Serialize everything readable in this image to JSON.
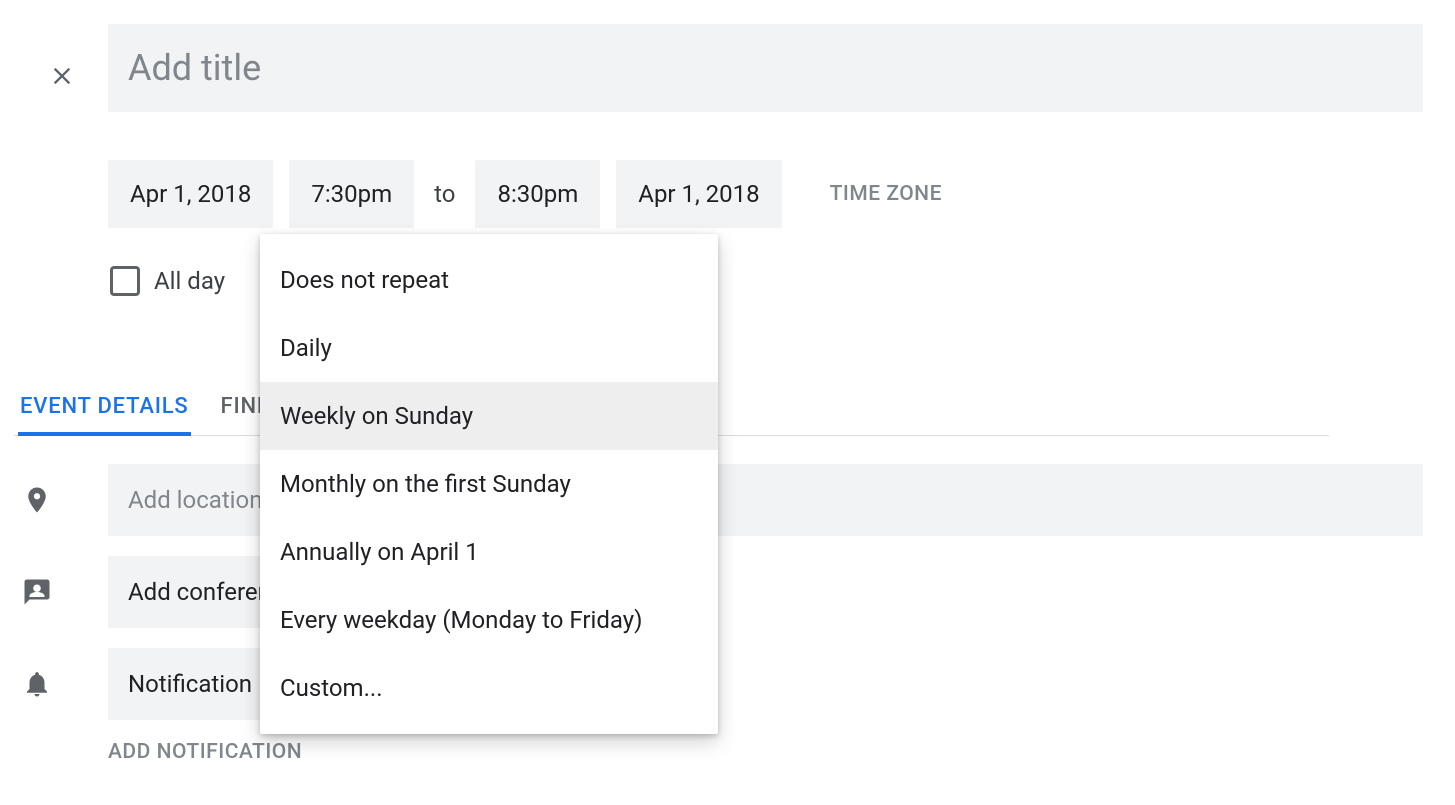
{
  "title": {
    "placeholder": "Add title",
    "value": ""
  },
  "datetime": {
    "start_date": "Apr 1, 2018",
    "start_time": "7:30pm",
    "to_label": "to",
    "end_time": "8:30pm",
    "end_date": "Apr 1, 2018",
    "timezone_label": "TIME ZONE"
  },
  "allday": {
    "label": "All day",
    "checked": false
  },
  "tabs": {
    "details": "EVENT DETAILS",
    "find_time": "FIND A TIME"
  },
  "details": {
    "location_placeholder": "Add location",
    "conferencing_label": "Add conferencing",
    "notification_label": "Notification",
    "add_notification": "ADD NOTIFICATION"
  },
  "repeat_menu": {
    "items": [
      "Does not repeat",
      "Daily",
      "Weekly on Sunday",
      "Monthly on the first Sunday",
      "Annually on April 1",
      "Every weekday (Monday to Friday)",
      "Custom..."
    ],
    "highlighted_index": 2
  }
}
